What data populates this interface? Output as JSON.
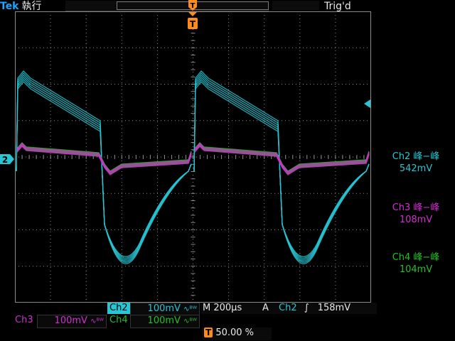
{
  "brand": {
    "logo": "Tek",
    "mode": "執行"
  },
  "trigger_status": "Trig'd",
  "markers": {
    "ground2": "2",
    "trigger_t": "T",
    "trigger_offset_t": "T"
  },
  "measurements": [
    {
      "label": "Ch2 峰−峰",
      "value": "542mV",
      "color": "#27c6d4"
    },
    {
      "label": "Ch3 峰−峰",
      "value": "108mV",
      "color": "#d12fd1"
    },
    {
      "label": "Ch4 峰−峰",
      "value": "104mV",
      "color": "#24c124"
    }
  ],
  "bottom": {
    "ch2_name": "Ch2",
    "ch2_scale": "100mV",
    "bw_symbol": "∿ᴮᵂ",
    "time_label": "M",
    "time_scale": "200µs",
    "trig_source_letter": "A",
    "trig_source": "Ch2",
    "trig_slope": "∫",
    "trig_level": "158mV",
    "ch3_name": "Ch3",
    "ch3_scale": "100mV",
    "ch4_name": "Ch4",
    "ch4_scale": "100mV",
    "trig_position": "50.00 %"
  },
  "colors": {
    "ch2": "#27c6d4",
    "ch3": "#d12fd1",
    "ch4": "#24c124",
    "trigger": "#ff8c1a",
    "grid": "#8a8a8a"
  }
}
